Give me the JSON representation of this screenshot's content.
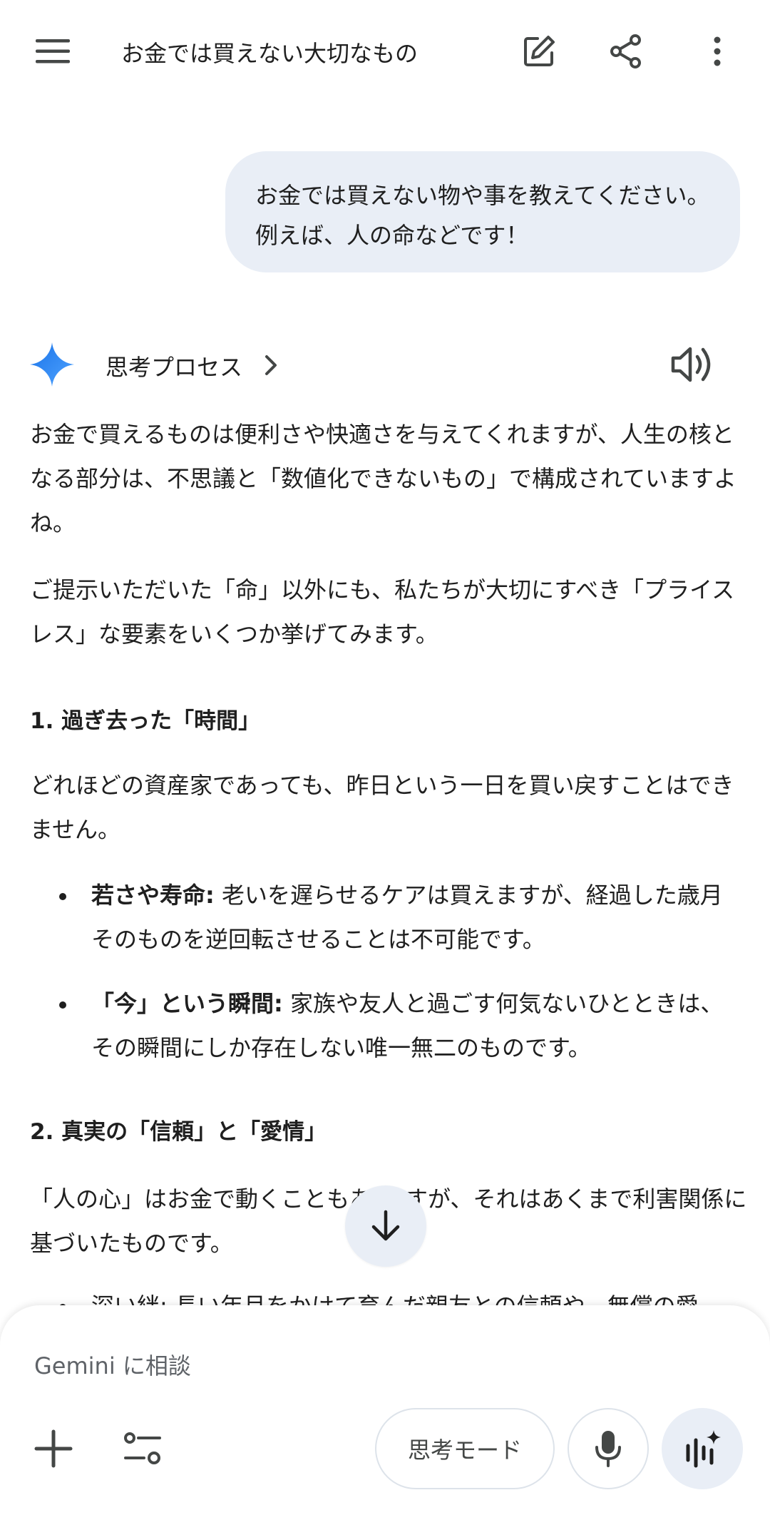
{
  "header": {
    "title": "お金では買えない大切なもの",
    "icons": [
      "menu-icon",
      "edit-icon",
      "share-icon",
      "more-vert-icon"
    ]
  },
  "user_message": {
    "line1": "お金では買えない物や事を教えてください。",
    "line2": "例えば、人の命などです！"
  },
  "response_header": {
    "thinking_label": "思考プロセス",
    "icons": [
      "gemini-star-icon",
      "chevron-right-icon",
      "speaker-icon"
    ]
  },
  "response": {
    "para1": "お金で買えるものは便利さや快適さを与えてくれますが、人生の核となる部分は、不思議と「数値化できないもの」で構成されていますよね。",
    "para2": "ご提示いただいた「命」以外にも、私たちが大切にすべき「プライスレス」な要素をいくつか挙げてみます。",
    "section1_heading": "1. 過ぎ去った「時間」",
    "section1_text": "どれほどの資産家であっても、昨日という一日を買い戻すことはできません。",
    "bullet1_bold": "若さや寿命:",
    "bullet1_text": " 老いを遅らせるケアは買えますが、経過した歳月そのものを逆回転させることは不可能です。",
    "bullet2_bold": "「今」という瞬間:",
    "bullet2_text": " 家族や友人と過ごす何気ないひとときは、その瞬間にしか存在しない唯一無二のものです。",
    "section2_heading": "2. 真実の「信頼」と「愛情」",
    "section2_text_a": "「人の心」はお金で動くこともあ",
    "section2_text_b": "すが、それはあくまで利害関係に基づいたものです。",
    "bullet3_partial": "深い絆: 長い年月をかけて育んだ親友との信頼や、無償の愛"
  },
  "input": {
    "placeholder": "Gemini に相談",
    "mode_label": "思考モード",
    "icons": [
      "plus-icon",
      "tools-icon",
      "mic-icon",
      "live-icon",
      "scroll-down-icon"
    ]
  },
  "colors": {
    "bubble": "#e9eef6",
    "text": "#1f1f1f",
    "placeholder": "#5f6368",
    "gemini_blue": "#4285f4"
  }
}
